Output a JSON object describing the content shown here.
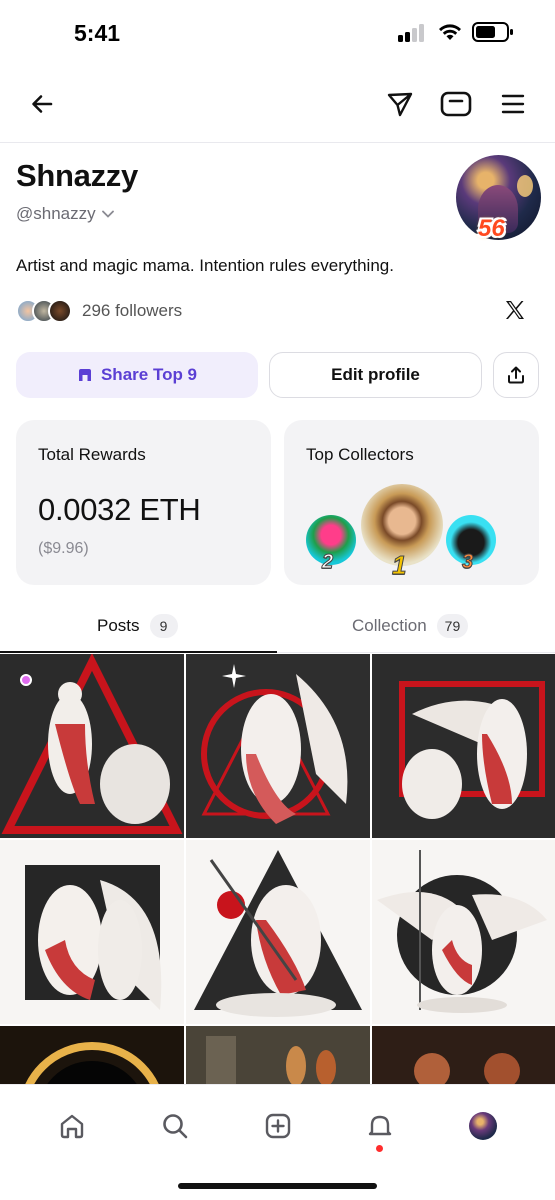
{
  "status_bar": {
    "time": "5:41"
  },
  "nav": {
    "back_icon": "arrow-left-icon",
    "send_icon": "paper-plane-icon",
    "frame_icon": "rounded-square-icon",
    "menu_icon": "hamburger-icon"
  },
  "profile": {
    "name": "Shnazzy",
    "handle": "@shnazzy",
    "streak": "56",
    "bio": "Artist and magic mama. Intention rules everything.",
    "followers": "296 followers"
  },
  "actions": {
    "share_label": "Share Top 9",
    "edit_label": "Edit profile"
  },
  "rewards": {
    "title": "Total Rewards",
    "value": "0.0032 ETH",
    "usd": "($9.96)"
  },
  "collectors": {
    "title": "Top Collectors",
    "items": [
      {
        "rank": "2"
      },
      {
        "rank": "1"
      },
      {
        "rank": "3"
      }
    ]
  },
  "tabs": [
    {
      "label": "Posts",
      "count": "9",
      "active": true
    },
    {
      "label": "Collection",
      "count": "79",
      "active": false
    }
  ],
  "colors": {
    "accent": "#5b3fd4",
    "accent_bg": "#f1eefc",
    "art_red": "#c8141c",
    "notification": "#ff2d2d"
  }
}
